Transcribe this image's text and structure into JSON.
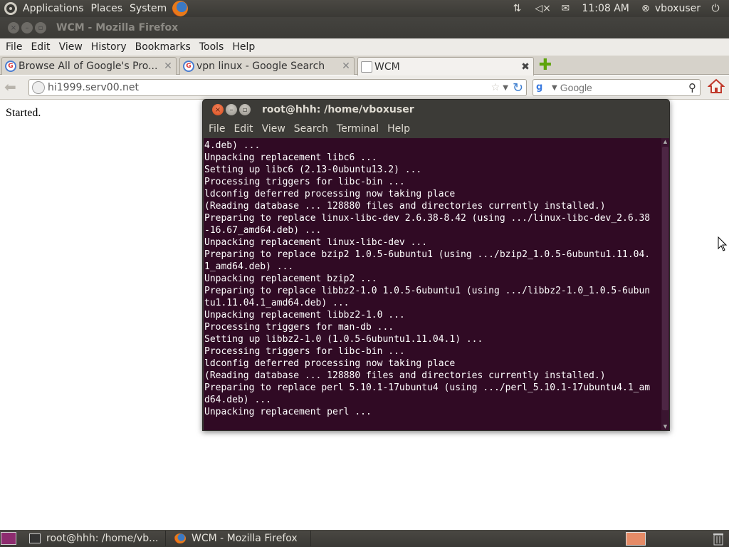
{
  "top_panel": {
    "menus": [
      "Applications",
      "Places",
      "System"
    ],
    "clock": "11:08 AM",
    "user": "vboxuser"
  },
  "firefox": {
    "window_title": "WCM - Mozilla Firefox",
    "menubar": [
      "File",
      "Edit",
      "View",
      "History",
      "Bookmarks",
      "Tools",
      "Help"
    ],
    "tabs": [
      {
        "label": "Browse All of Google's Pro..."
      },
      {
        "label": "vpn linux - Google Search"
      },
      {
        "label": "WCM"
      }
    ],
    "url": "hi1999.serv00.net",
    "search_placeholder": "Google",
    "page_text": "Started."
  },
  "terminal": {
    "title": "root@hhh: /home/vboxuser",
    "menubar": [
      "File",
      "Edit",
      "View",
      "Search",
      "Terminal",
      "Help"
    ],
    "lines": [
      "4.deb) ...",
      "Unpacking replacement libc6 ...",
      "Setting up libc6 (2.13-0ubuntu13.2) ...",
      "Processing triggers for libc-bin ...",
      "ldconfig deferred processing now taking place",
      "(Reading database ... 128880 files and directories currently installed.)",
      "Preparing to replace linux-libc-dev 2.6.38-8.42 (using .../linux-libc-dev_2.6.38",
      "-16.67_amd64.deb) ...",
      "Unpacking replacement linux-libc-dev ...",
      "Preparing to replace bzip2 1.0.5-6ubuntu1 (using .../bzip2_1.0.5-6ubuntu1.11.04.",
      "1_amd64.deb) ...",
      "Unpacking replacement bzip2 ...",
      "Preparing to replace libbz2-1.0 1.0.5-6ubuntu1 (using .../libbz2-1.0_1.0.5-6ubun",
      "tu1.11.04.1_amd64.deb) ...",
      "Unpacking replacement libbz2-1.0 ...",
      "Processing triggers for man-db ...",
      "Setting up libbz2-1.0 (1.0.5-6ubuntu1.11.04.1) ...",
      "Processing triggers for libc-bin ...",
      "ldconfig deferred processing now taking place",
      "(Reading database ... 128880 files and directories currently installed.)",
      "Preparing to replace perl 5.10.1-17ubuntu4 (using .../perl_5.10.1-17ubuntu4.1_am",
      "d64.deb) ...",
      "Unpacking replacement perl ..."
    ]
  },
  "taskbar": {
    "tasks": [
      {
        "label": "root@hhh: /home/vb...",
        "icon": "terminal-icon"
      },
      {
        "label": "WCM - Mozilla Firefox",
        "icon": "firefox-icon"
      }
    ]
  },
  "colors": {
    "terminal_bg": "#300a24",
    "panel_bg": "#3c3b37",
    "close_button": "#e05a2b"
  }
}
